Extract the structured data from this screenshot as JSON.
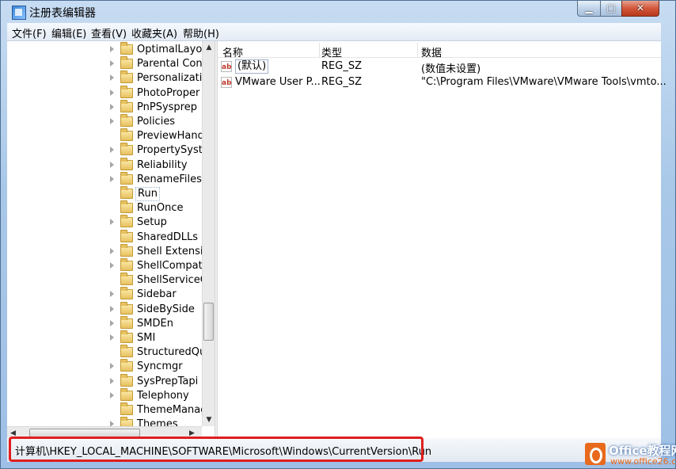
{
  "window": {
    "title": "注册表编辑器"
  },
  "menu": [
    "文件(F)",
    "编辑(E)",
    "查看(V)",
    "收藏夹(A)",
    "帮助(H)"
  ],
  "tree": {
    "items": [
      {
        "label": "OptimalLayo",
        "expandable": true
      },
      {
        "label": "Parental Con",
        "expandable": true
      },
      {
        "label": "Personalizati",
        "expandable": true
      },
      {
        "label": "PhotoProper",
        "expandable": true
      },
      {
        "label": "PnPSysprep",
        "expandable": true
      },
      {
        "label": "Policies",
        "expandable": true
      },
      {
        "label": "PreviewHand",
        "expandable": false
      },
      {
        "label": "PropertySyst",
        "expandable": true
      },
      {
        "label": "Reliability",
        "expandable": true
      },
      {
        "label": "RenameFiles",
        "expandable": true
      },
      {
        "label": "Run",
        "expandable": false,
        "selected": true
      },
      {
        "label": "RunOnce",
        "expandable": false
      },
      {
        "label": "Setup",
        "expandable": true
      },
      {
        "label": "SharedDLLs",
        "expandable": false
      },
      {
        "label": "Shell Extensic",
        "expandable": true
      },
      {
        "label": "ShellCompat",
        "expandable": true
      },
      {
        "label": "ShellServiceC",
        "expandable": false
      },
      {
        "label": "Sidebar",
        "expandable": true
      },
      {
        "label": "SideBySide",
        "expandable": true
      },
      {
        "label": "SMDEn",
        "expandable": true
      },
      {
        "label": "SMI",
        "expandable": true
      },
      {
        "label": "StructuredQu",
        "expandable": false
      },
      {
        "label": "Syncmgr",
        "expandable": true
      },
      {
        "label": "SysPrepTapi",
        "expandable": true
      },
      {
        "label": "Telephony",
        "expandable": true
      },
      {
        "label": "ThemeManag",
        "expandable": false
      },
      {
        "label": "Themes",
        "expandable": true
      }
    ]
  },
  "list": {
    "columns": [
      "名称",
      "类型",
      "数据"
    ],
    "rows": [
      {
        "name": "(默认)",
        "type": "REG_SZ",
        "data": "(数值未设置)"
      },
      {
        "name": "VMware User P...",
        "type": "REG_SZ",
        "data": "\"C:\\Program Files\\VMware\\VMware Tools\\vmto..."
      }
    ]
  },
  "status": {
    "path": "计算机\\HKEY_LOCAL_MACHINE\\SOFTWARE\\Microsoft\\Windows\\CurrentVersion\\Run"
  },
  "icons": {
    "app": "registry-editor-icon",
    "folder": "folder-icon",
    "string_value": "string-value-icon",
    "string_value_glyph": "ab"
  },
  "watermark": {
    "title": "Office教程网",
    "subtitle": "www.office26.com"
  },
  "colors": {
    "highlight": "#e01e1e",
    "watermark_accent": "#e86a1d"
  }
}
